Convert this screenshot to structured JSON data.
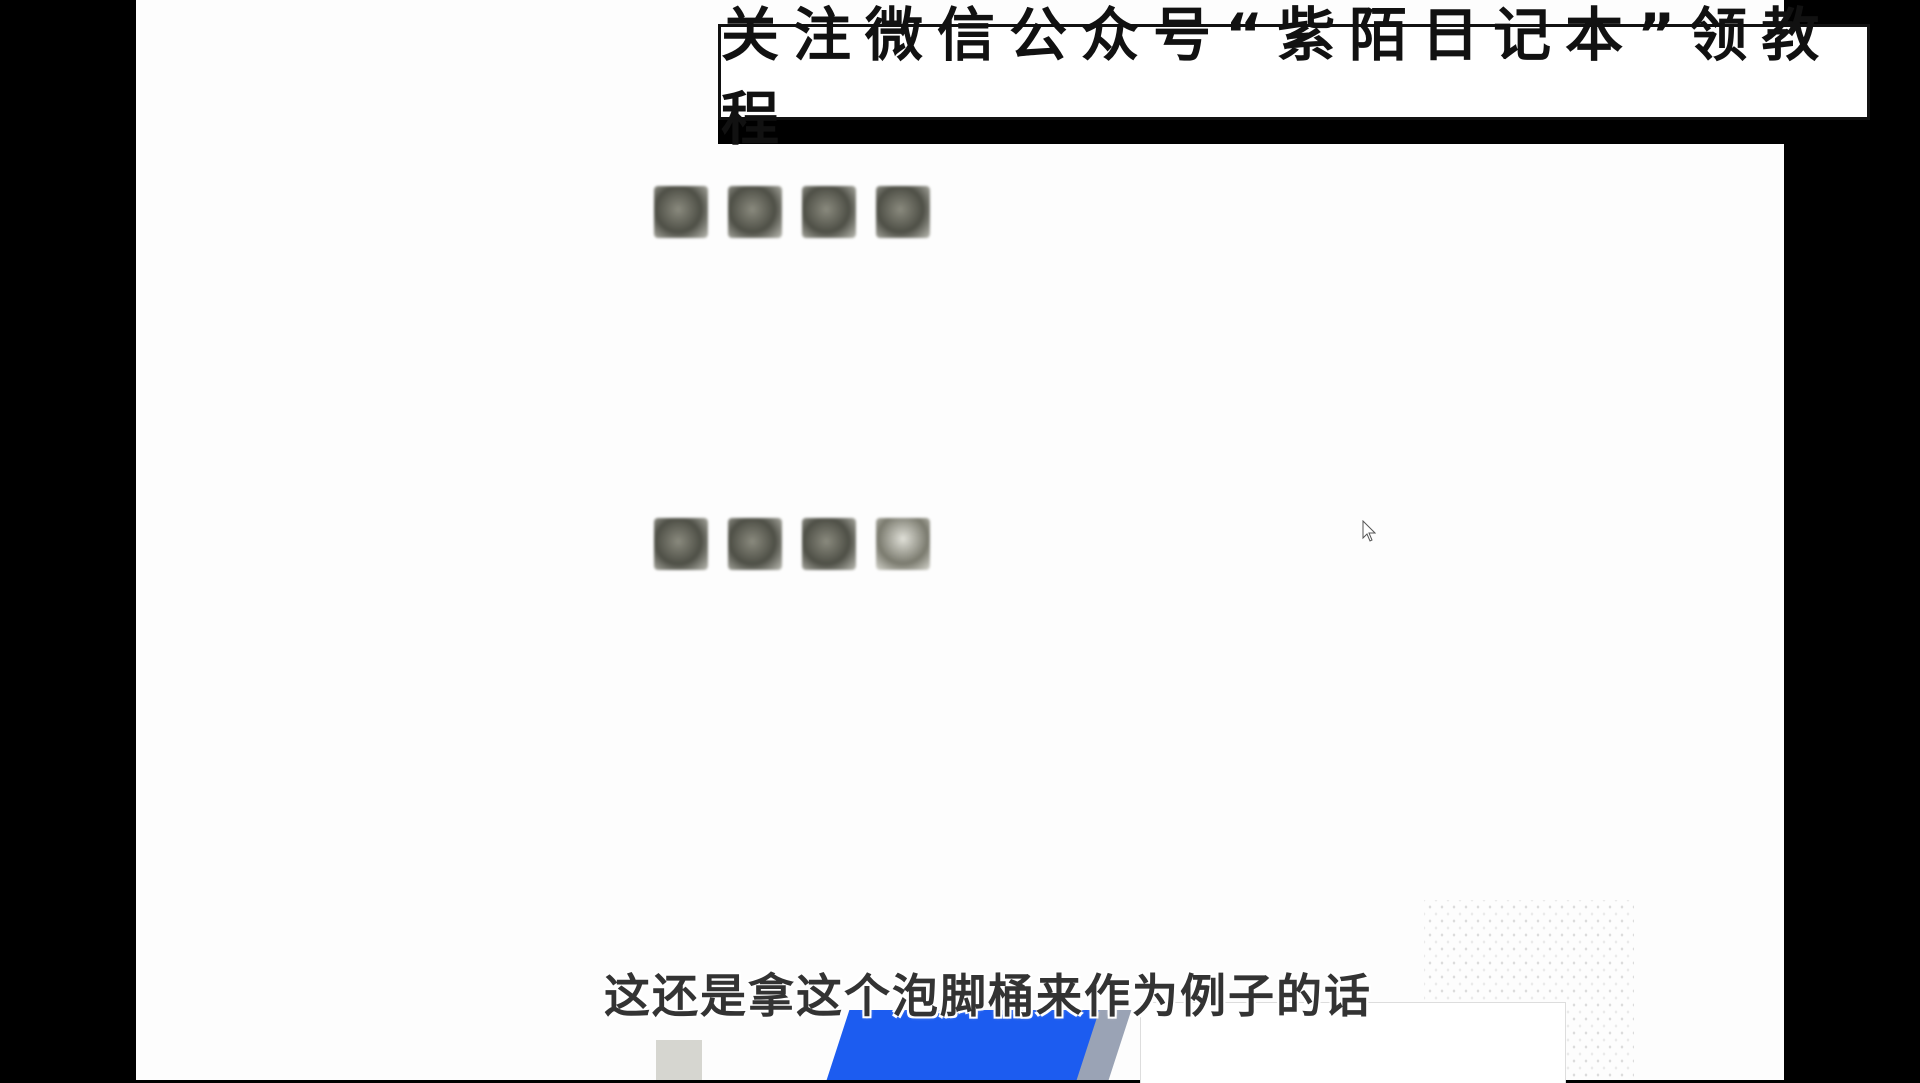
{
  "banner": {
    "text": "关注微信公众号“紫陌日记本”领教程"
  },
  "subtitle": {
    "text": "这还是拿这个泡脚桶来作为例子的话"
  },
  "reviews": [
    {
      "label": "",
      "text": "",
      "followup_label": "",
      "followup_text": "",
      "spec": "",
      "meta": ""
    },
    {
      "label": "",
      "text": "",
      "followup_label": "",
      "followup_text": "",
      "spec": "",
      "meta": ""
    },
    {
      "label": "",
      "text": ""
    },
    {
      "label": "",
      "text": ""
    }
  ],
  "colors": {
    "page_bg": "#fdfdfd",
    "accent_blue": "#1c5cf0"
  },
  "icons": {
    "cursor": "mouse-pointer-icon"
  }
}
